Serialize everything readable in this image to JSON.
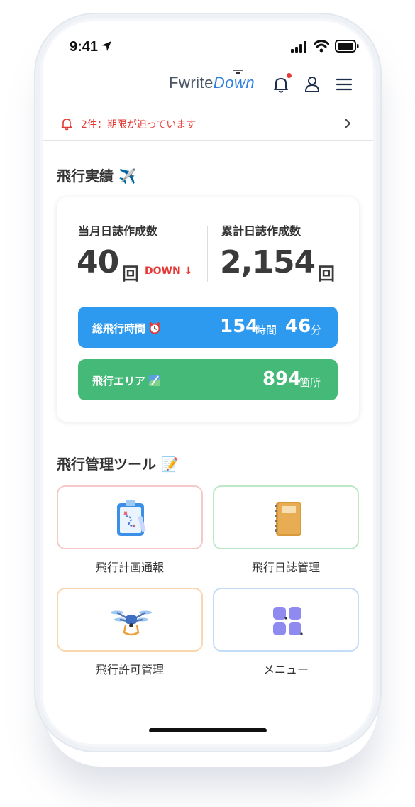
{
  "status_bar": {
    "time": "9:41"
  },
  "header": {
    "logo_main": "Fwrite",
    "logo_accent": "Down"
  },
  "notice": {
    "text": "2件：期限が迫っています"
  },
  "flight_record": {
    "title": "飛行実績 ✈️",
    "monthly_label": "当月日誌作成数",
    "monthly_value": "40",
    "monthly_unit": "回",
    "monthly_trend": "DOWN ↓",
    "total_label": "累計日誌作成数",
    "total_value": "2,154",
    "total_unit": "回",
    "flight_time_label": "総飛行時間",
    "flight_time_hours": "154",
    "flight_time_hours_unit": "時間",
    "flight_time_minutes": "46",
    "flight_time_minutes_unit": "分",
    "area_label": "飛行エリア",
    "area_value": "894",
    "area_unit": "箇所"
  },
  "tools": {
    "title": "飛行管理ツール 📝",
    "items": [
      {
        "label": "飛行計画通報",
        "icon": "clipboard-map-icon",
        "border": "#f6c9c9"
      },
      {
        "label": "飛行日誌管理",
        "icon": "notebook-icon",
        "border": "#bde8c8"
      },
      {
        "label": "飛行許可管理",
        "icon": "drone-icon",
        "border": "#f7d6b0"
      },
      {
        "label": "メニュー",
        "icon": "grid-menu-icon",
        "border": "#c4dcf5"
      }
    ]
  },
  "colors": {
    "alert": "#e53935",
    "blue_bar": "#2d9af0",
    "green_bar": "#45b978"
  }
}
